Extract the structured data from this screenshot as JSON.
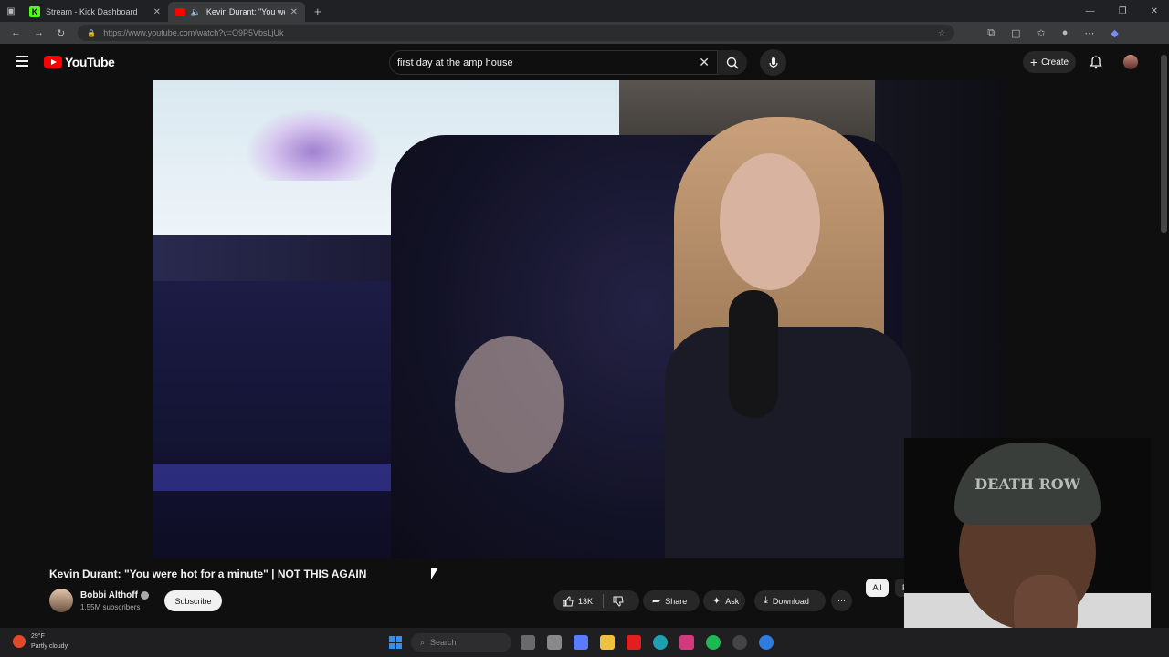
{
  "browser": {
    "tabs": [
      {
        "label": "Stream - Kick Dashboard",
        "active": false
      },
      {
        "label": "Kevin Durant: \"You were hot",
        "active": true
      }
    ],
    "new_tab": "+",
    "url": "https://www.youtube.com/watch?v=O9P5VbsLjUk"
  },
  "header": {
    "logo_text": "YouTube",
    "search_value": "first day at the amp house",
    "create_label": "Create"
  },
  "video": {
    "title": "Kevin Durant: \"You were hot for a minute\" | NOT THIS AGAIN",
    "channel": "Bobbi Althoff",
    "subscribers": "1.55M subscribers",
    "subscribe_label": "Subscribe",
    "likes": "13K",
    "share_label": "Share",
    "ask_label": "Ask",
    "download_label": "Download"
  },
  "chips": {
    "all": "All",
    "from": "From B"
  },
  "webcam": {
    "hat_text": "DEATH ROW"
  },
  "taskbar": {
    "temp": "29°F",
    "condition": "Partly cloudy",
    "search_placeholder": "Search"
  },
  "colors": {
    "yt_red": "#ff0000",
    "kick_green": "#53fc18",
    "bg": "#0f0f0f"
  }
}
